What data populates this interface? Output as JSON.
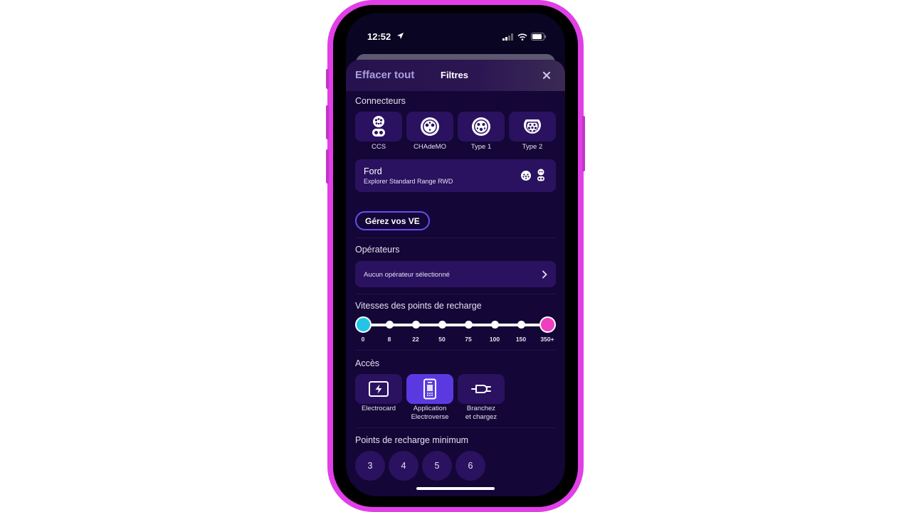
{
  "status": {
    "time": "12:52"
  },
  "header": {
    "clear_all": "Effacer tout",
    "title": "Filtres"
  },
  "connectors": {
    "label": "Connecteurs",
    "items": [
      {
        "name": "CCS"
      },
      {
        "name": "CHAdeMO"
      },
      {
        "name": "Type 1"
      },
      {
        "name": "Type 2"
      }
    ]
  },
  "vehicle": {
    "make": "Ford",
    "model": "Explorer Standard Range RWD"
  },
  "manage_button": "Gérez vos VE",
  "operators": {
    "label": "Opérateurs",
    "value": "Aucun opérateur sélectionné"
  },
  "speeds": {
    "label": "Vitesses des points de recharge",
    "ticks": [
      "0",
      "8",
      "22",
      "50",
      "75",
      "100",
      "150",
      "350+"
    ],
    "selected_min": "0",
    "selected_max": "350+"
  },
  "access": {
    "label": "Accès",
    "items": [
      {
        "line1": "Electrocard",
        "line2": "",
        "active": false
      },
      {
        "line1": "Application",
        "line2": "Electroverse",
        "active": true
      },
      {
        "line1": "Branchez",
        "line2": "et chargez",
        "active": false
      }
    ]
  },
  "min_points": {
    "label": "Points de recharge minimum",
    "options": [
      "3",
      "4",
      "5",
      "6"
    ]
  },
  "colors": {
    "frame": "#e040e6",
    "background": "#140636",
    "tile": "#2a1260",
    "accent": "#5a3ae0",
    "knob_min": "#22c4e8",
    "knob_max": "#ee3fc0"
  }
}
